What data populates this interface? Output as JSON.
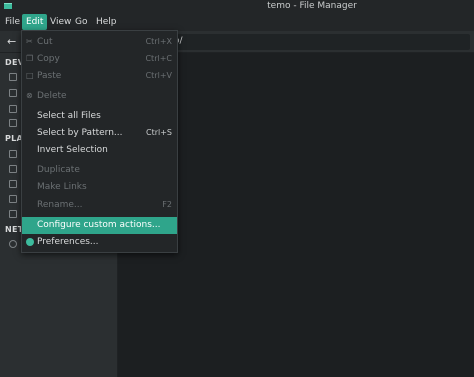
{
  "window": {
    "title": "temo - File Manager"
  },
  "menubar": [
    {
      "label": "File"
    },
    {
      "label": "Edit"
    },
    {
      "label": "View"
    },
    {
      "label": "Go"
    },
    {
      "label": "Help"
    }
  ],
  "toolbar": {
    "path": "o/"
  },
  "sidebar": {
    "sections": [
      {
        "label": "DEVI"
      },
      {
        "label": "PLAC"
      },
      {
        "label": "NETV"
      }
    ]
  },
  "edit_menu": {
    "items": [
      {
        "label": "Cut",
        "shortcut": "Ctrl+X",
        "enabled": false,
        "icon": "cut-icon"
      },
      {
        "label": "Copy",
        "shortcut": "Ctrl+C",
        "enabled": false,
        "icon": "copy-icon"
      },
      {
        "label": "Paste",
        "shortcut": "Ctrl+V",
        "enabled": false,
        "icon": "paste-icon"
      },
      {
        "label": "Delete",
        "shortcut": "",
        "enabled": false,
        "icon": "delete-icon"
      },
      {
        "label": "Select all Files",
        "shortcut": "",
        "enabled": true
      },
      {
        "label": "Select by Pattern...",
        "shortcut": "Ctrl+S",
        "enabled": true
      },
      {
        "label": "Invert Selection",
        "shortcut": "",
        "enabled": true
      },
      {
        "label": "Duplicate",
        "shortcut": "",
        "enabled": false
      },
      {
        "label": "Make Links",
        "shortcut": "",
        "enabled": false
      },
      {
        "label": "Rename...",
        "shortcut": "F2",
        "enabled": false
      },
      {
        "label": "Configure custom actions...",
        "shortcut": "",
        "enabled": true,
        "highlighted": true
      },
      {
        "label": "Preferences...",
        "shortcut": "",
        "enabled": true,
        "icon": "preferences-icon"
      }
    ]
  },
  "colors": {
    "accent": "#2fa58b",
    "background": "#2b2f31",
    "panel": "#1c1f21"
  }
}
